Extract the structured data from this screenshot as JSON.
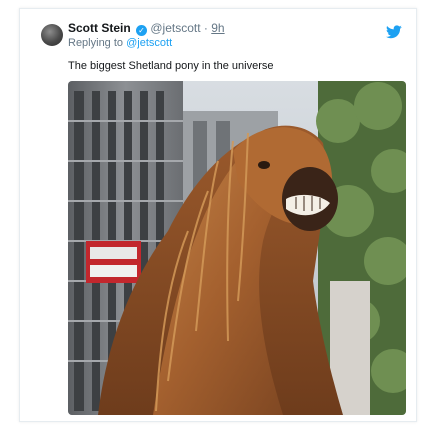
{
  "tweet": {
    "author_name": "Scott Stein",
    "handle": "@jetscott",
    "separator": "·",
    "time": "9h",
    "reply_prefix": "Replying to",
    "reply_to": "@jetscott",
    "text": "The biggest Shetland pony in the universe",
    "verified_icon": "verified-badge-icon",
    "platform_icon": "twitter-bird-icon"
  },
  "colors": {
    "accent": "#1da1f2",
    "text": "#14171a",
    "muted": "#657786",
    "border": "#e6ecf0"
  }
}
